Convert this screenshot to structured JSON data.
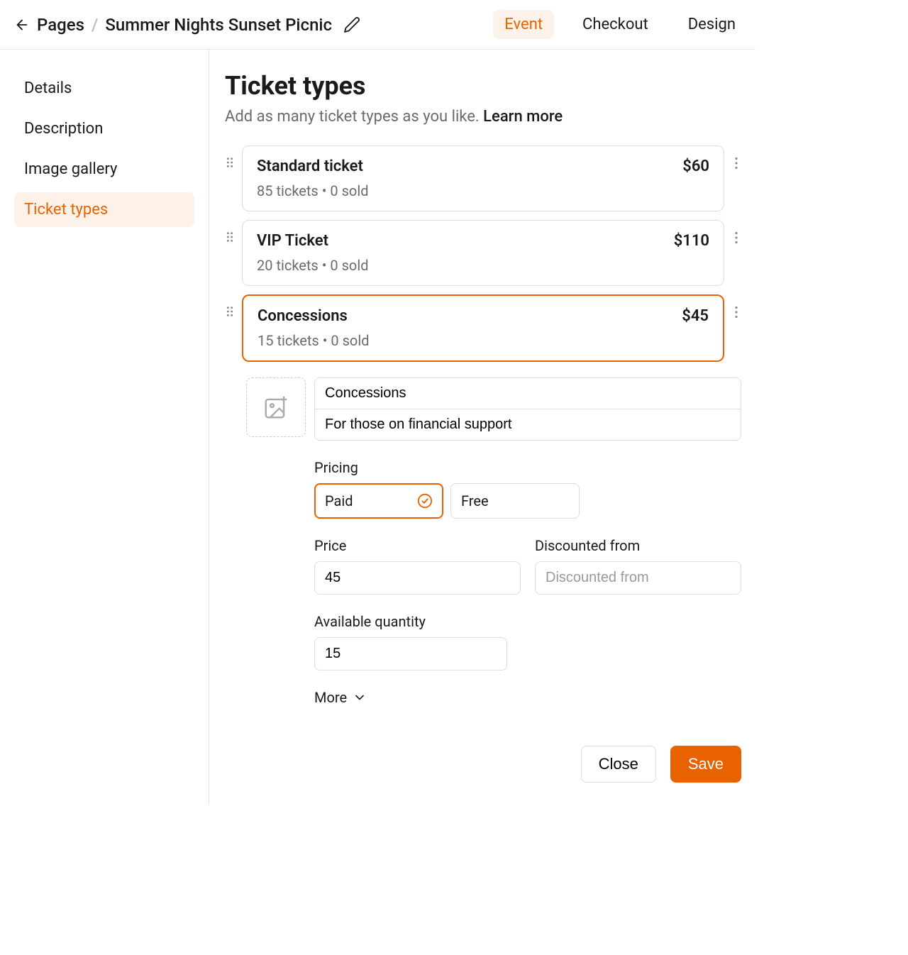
{
  "header": {
    "back_label": "Pages",
    "title": "Summer Nights Sunset Picnic",
    "tabs": [
      {
        "label": "Event",
        "active": true
      },
      {
        "label": "Checkout",
        "active": false
      },
      {
        "label": "Design",
        "active": false
      }
    ]
  },
  "sidebar": {
    "items": [
      {
        "label": "Details",
        "active": false
      },
      {
        "label": "Description",
        "active": false
      },
      {
        "label": "Image gallery",
        "active": false
      },
      {
        "label": "Ticket types",
        "active": true
      }
    ]
  },
  "page": {
    "title": "Ticket types",
    "desc": "Add as many ticket types as you like. ",
    "learn_more": "Learn more"
  },
  "tickets": [
    {
      "name": "Standard ticket",
      "price": "$60",
      "sub": "85 tickets • 0 sold",
      "selected": false
    },
    {
      "name": "VIP Ticket",
      "price": "$110",
      "sub": "20 tickets • 0 sold",
      "selected": false
    },
    {
      "name": "Concessions",
      "price": "$45",
      "sub": "15 tickets • 0 sold",
      "selected": true
    }
  ],
  "edit": {
    "name": "Concessions",
    "desc": "For those on financial support",
    "pricing_label": "Pricing",
    "pricing": {
      "paid": "Paid",
      "free": "Free",
      "selected": "paid"
    },
    "price_label": "Price",
    "price": "45",
    "discount_label": "Discounted from",
    "discount_placeholder": "Discounted from",
    "discount": "",
    "qty_label": "Available quantity",
    "qty": "15",
    "more_label": "More"
  },
  "footer": {
    "close": "Close",
    "save": "Save"
  }
}
